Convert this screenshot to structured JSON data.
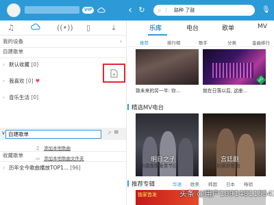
{
  "topbar": {
    "vip": "VIP",
    "search_value": "路种 了鼓",
    "bg_color": "#2d9ad8"
  },
  "left_tabs": [
    "music-note-icon",
    "cloud-icon",
    "radio-icon",
    "device-icon",
    "download-icon"
  ],
  "sidebar": {
    "my_device": "我的设备",
    "created_playlists": "自建歌单",
    "items": [
      {
        "label": "默认收藏",
        "count": "[0]"
      },
      {
        "label": "我喜欢",
        "count": "[0]"
      },
      {
        "label": "音乐生活",
        "count": "[0]"
      }
    ],
    "editing_value": "自建歌单",
    "add_local_song": "添加本地歌曲",
    "add_local_folder": "添加本地歌曲文件夹",
    "collected_playlists": "收藏歌单",
    "collected_item": {
      "label": "历年全今歌曲播放TOP1...",
      "count": "[96]"
    }
  },
  "main_tabs": [
    "乐库",
    "电台",
    "歌单",
    "MV"
  ],
  "sub_tabs": [
    "推荐",
    "排行榜",
    "歌手",
    "分类",
    "金曲排行"
  ],
  "tiles_top": [
    {
      "caption": "致未来的另一半: 你..."
    },
    {
      "caption": "就在日落以后, 这座..."
    }
  ],
  "mv_section": "精选MV电台",
  "mv_tiles": [
    {
      "caption": "全新偶像爆发类节目",
      "title": "明日之子"
    },
    {
      "caption": "深宫剧的奥妙歌曲",
      "title": "宫廷剧"
    }
  ],
  "recommend": {
    "title": "推荐专辑",
    "tabs": [
      "华语",
      "欧美",
      "韩国",
      "日本",
      "畅销"
    ]
  },
  "bottom_banner": "独家首发",
  "watermark": "头条 @用户1091481155438",
  "hq_badge": "HQ"
}
